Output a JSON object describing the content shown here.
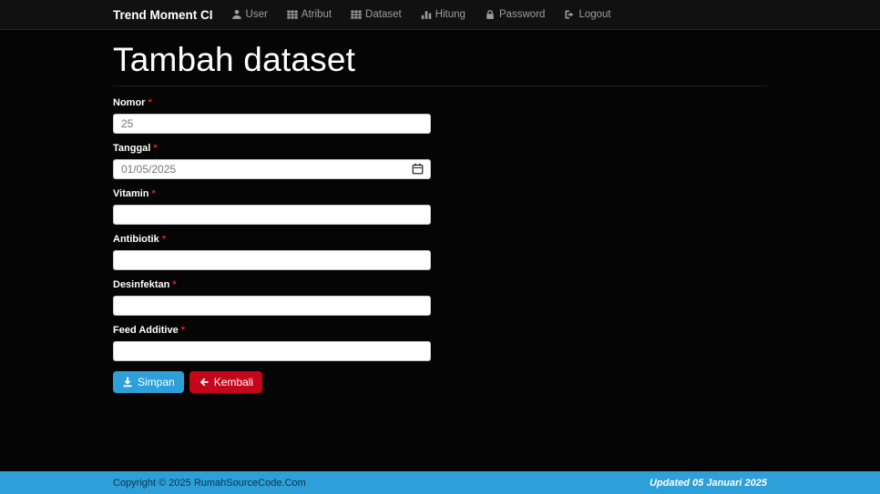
{
  "navbar": {
    "brand": "Trend Moment CI",
    "items": [
      {
        "label": "User",
        "icon": "user-icon"
      },
      {
        "label": "Atribut",
        "icon": "grid-icon"
      },
      {
        "label": "Dataset",
        "icon": "grid-icon"
      },
      {
        "label": "Hitung",
        "icon": "bar-chart-icon"
      },
      {
        "label": "Password",
        "icon": "lock-icon"
      },
      {
        "label": "Logout",
        "icon": "logout-icon"
      }
    ]
  },
  "page": {
    "title": "Tambah dataset"
  },
  "form": {
    "required_marker": "*",
    "fields": [
      {
        "label": "Nomor",
        "value": "25",
        "type": "text"
      },
      {
        "label": "Tanggal",
        "value": "01/05/2025",
        "type": "date"
      },
      {
        "label": "Vitamin",
        "value": "",
        "type": "text"
      },
      {
        "label": "Antibiotik",
        "value": "",
        "type": "text"
      },
      {
        "label": "Desinfektan",
        "value": "",
        "type": "text"
      },
      {
        "label": "Feed Additive",
        "value": "",
        "type": "text"
      }
    ],
    "buttons": {
      "save": "Simpan",
      "back": "Kembali"
    }
  },
  "footer": {
    "copyright": "Copyright © 2025 RumahSourceCode.Com",
    "updated": "Updated 05 Januari 2025"
  },
  "colors": {
    "accent_blue": "#2d9fd9",
    "danger_red": "#c50519",
    "footer_blue": "#2d9fd9",
    "navbar_bg": "#111111",
    "body_bg": "#050505"
  }
}
